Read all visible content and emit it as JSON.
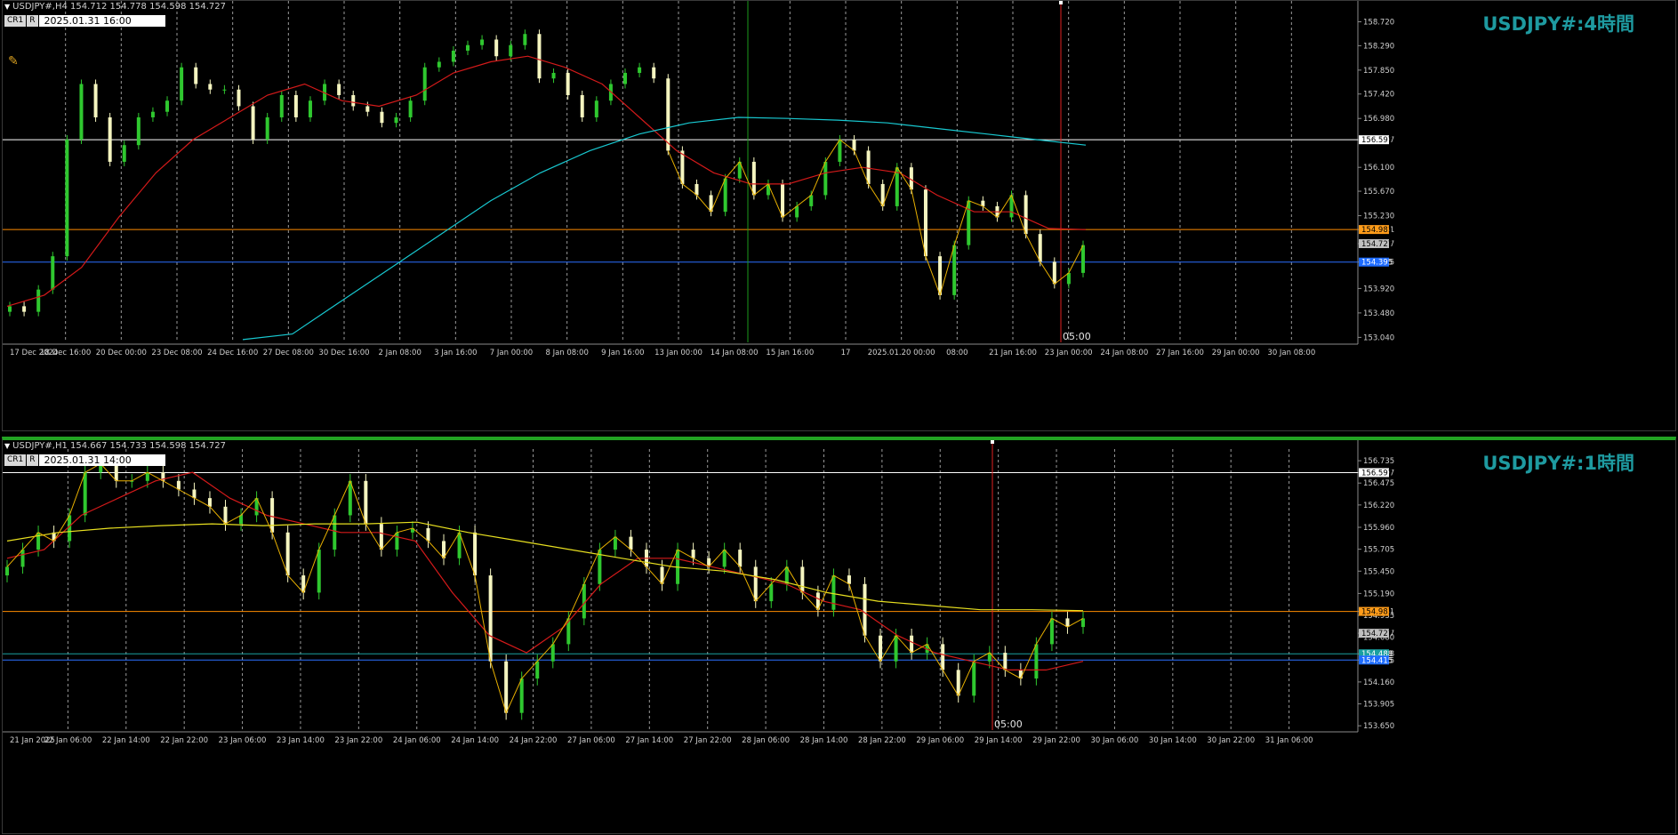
{
  "pane_h4": {
    "header": "USDJPY#,H4  154.712 154.778 154.598 154.727",
    "cr_label": "CR1",
    "r_label": "R",
    "datetime": "2025.01.31 16:00",
    "title": "USDJPY#:4時間",
    "y_ticks": [
      "158.720",
      "158.290",
      "157.850",
      "157.420",
      "156.980",
      "156.597",
      "156.100",
      "155.670",
      "155.230",
      "154.981",
      "154.727",
      "154.395",
      "153.920",
      "153.480",
      "153.040"
    ],
    "y_ticks_values": [
      158.72,
      158.29,
      157.85,
      157.42,
      156.98,
      156.597,
      156.1,
      155.67,
      155.23,
      154.981,
      154.727,
      154.395,
      153.92,
      153.48,
      153.04
    ],
    "highlight_labels": [
      {
        "text": "156.597",
        "bg": "#ffffff",
        "fg": "#000000",
        "value": 156.597
      },
      {
        "text": "154.981",
        "bg": "#ff9c1a",
        "fg": "#000000",
        "value": 154.981
      },
      {
        "text": "154.727",
        "bg": "#c0c0c0",
        "fg": "#000000",
        "value": 154.727
      },
      {
        "text": "154.395",
        "bg": "#1e6cff",
        "fg": "#ffffff",
        "value": 154.395
      }
    ],
    "x_labels": [
      "17 Dec 2024",
      "18 Dec 16:00",
      "20 Dec 00:00",
      "23 Dec 08:00",
      "24 Dec 16:00",
      "27 Dec 08:00",
      "30 Dec 16:00",
      "2 Jan 08:00",
      "3 Jan 16:00",
      "7 Jan 00:00",
      "8 Jan 08:00",
      "9 Jan 16:00",
      "13 Jan 00:00",
      "14 Jan 08:00",
      "15 Jan 16:00",
      "17",
      "2025.01.20 00:00",
      "08:00",
      "21 Jan 16:00",
      "23 Jan 00:00",
      "24 Jan 08:00",
      "27 Jan 16:00",
      "29 Jan 00:00",
      "30 Jan 08:00"
    ],
    "cursor_time": "05:00",
    "colors": {
      "ma_short": "#d41a1a",
      "ma_long": "#18c8d0",
      "zigzag": "#e8b000",
      "hline_white": "#ffffff",
      "hline_orange": "#ff8c00",
      "hline_blue": "#2a6fff",
      "vline_red": "#e02020",
      "vline_green": "#1c9a1c",
      "candle_bull": "#2fc82f",
      "candle_bear": "#f5f5c0"
    }
  },
  "pane_h1": {
    "header": "USDJPY#,H1  154.667 154.733 154.598 154.727",
    "cr_label": "CR1",
    "r_label": "R",
    "datetime": "2025.01.31 14:00",
    "title": "USDJPY#:1時間",
    "y_ticks": [
      "156.735",
      "156.597",
      "156.475",
      "156.220",
      "155.960",
      "155.705",
      "155.450",
      "155.190",
      "154.981",
      "154.935",
      "154.727",
      "154.680",
      "154.488",
      "154.415",
      "154.160",
      "153.905",
      "153.650"
    ],
    "y_ticks_values": [
      156.735,
      156.597,
      156.475,
      156.22,
      155.96,
      155.705,
      155.45,
      155.19,
      154.981,
      154.935,
      154.727,
      154.68,
      154.488,
      154.415,
      154.16,
      153.905,
      153.65
    ],
    "highlight_labels": [
      {
        "text": "156.597",
        "bg": "#ffffff",
        "fg": "#000000",
        "value": 156.597
      },
      {
        "text": "154.981",
        "bg": "#ff9c1a",
        "fg": "#000000",
        "value": 154.981
      },
      {
        "text": "154.727",
        "bg": "#c0c0c0",
        "fg": "#000000",
        "value": 154.727
      },
      {
        "text": "154.488",
        "bg": "#1aa0a0",
        "fg": "#ffffff",
        "value": 154.488
      },
      {
        "text": "154.415",
        "bg": "#1e6cff",
        "fg": "#ffffff",
        "value": 154.415
      }
    ],
    "x_labels": [
      "21 Jan 2025",
      "22 Jan 06:00",
      "22 Jan 14:00",
      "22 Jan 22:00",
      "23 Jan 06:00",
      "23 Jan 14:00",
      "23 Jan 22:00",
      "24 Jan 06:00",
      "24 Jan 14:00",
      "24 Jan 22:00",
      "27 Jan 06:00",
      "27 Jan 14:00",
      "27 Jan 22:00",
      "28 Jan 06:00",
      "28 Jan 14:00",
      "28 Jan 22:00",
      "29 Jan 06:00",
      "29 Jan 14:00",
      "29 Jan 22:00",
      "30 Jan 06:00",
      "30 Jan 14:00",
      "30 Jan 22:00",
      "31 Jan 06:00"
    ],
    "cursor_time": "05:00",
    "colors": {
      "ma_short": "#d41a1a",
      "ma_long": "#e8e020",
      "zigzag": "#e8b000",
      "hline_white": "#ffffff",
      "hline_orange": "#ff8c00",
      "hline_teal": "#1aa0a0",
      "hline_blue": "#2a6fff",
      "vline_red": "#e02020",
      "candle_bull": "#2fc82f",
      "candle_bear": "#f5f5c0"
    }
  },
  "chart_data": [
    {
      "type": "candlestick",
      "title": "USDJPY#:4時間",
      "ylim": [
        152.95,
        159.0
      ],
      "series": [
        {
          "name": "close",
          "values": [
            153.6,
            153.5,
            153.9,
            154.5,
            156.6,
            157.6,
            157.0,
            156.2,
            156.5,
            157.0,
            157.1,
            157.3,
            157.9,
            157.6,
            157.5,
            157.5,
            157.2,
            156.6,
            157.0,
            157.4,
            157.0,
            157.3,
            157.6,
            157.4,
            157.2,
            157.1,
            156.9,
            157.0,
            157.3,
            157.9,
            158.0,
            158.2,
            158.3,
            158.4,
            158.1,
            158.3,
            158.5,
            157.7,
            157.8,
            157.4,
            157.0,
            157.3,
            157.6,
            157.8,
            157.9,
            157.7,
            156.4,
            155.8,
            155.6,
            155.3,
            155.9,
            156.2,
            155.6,
            155.8,
            155.2,
            155.4,
            155.6,
            156.2,
            156.6,
            156.4,
            155.8,
            155.4,
            156.1,
            155.7,
            154.5,
            153.8,
            154.7,
            155.5,
            155.4,
            155.2,
            155.6,
            154.9,
            154.4,
            154.0,
            154.2,
            154.7
          ]
        }
      ],
      "moving_averages": [
        {
          "color": "#d41a1a",
          "values": [
            153.6,
            153.8,
            154.3,
            155.2,
            156.0,
            156.6,
            157.0,
            157.4,
            157.6,
            157.3,
            157.2,
            157.4,
            157.8,
            158.0,
            158.1,
            157.9,
            157.6,
            157.0,
            156.4,
            156.0,
            155.8,
            155.8,
            156.0,
            156.1,
            156.0,
            155.6,
            155.3,
            155.3,
            155.0,
            154.98
          ]
        },
        {
          "color": "#18c8d0",
          "values": [
            153.0,
            153.1,
            153.7,
            154.3,
            154.9,
            155.5,
            156.0,
            156.4,
            156.7,
            156.9,
            157.0,
            156.98,
            156.95,
            156.9,
            156.8,
            156.7,
            156.6,
            156.5
          ]
        }
      ],
      "horizontal_lines": [
        156.597,
        154.981,
        154.395
      ]
    },
    {
      "type": "candlestick",
      "title": "USDJPY#:1時間",
      "ylim": [
        153.6,
        156.85
      ],
      "series": [
        {
          "name": "close",
          "values": [
            155.5,
            155.7,
            155.9,
            155.8,
            156.1,
            156.6,
            156.7,
            156.5,
            156.5,
            156.6,
            156.5,
            156.4,
            156.3,
            156.2,
            156.0,
            156.1,
            156.3,
            155.9,
            155.4,
            155.2,
            155.7,
            156.1,
            156.5,
            156.0,
            155.7,
            155.9,
            155.95,
            155.8,
            155.6,
            155.9,
            155.4,
            154.4,
            153.8,
            154.2,
            154.4,
            154.6,
            154.9,
            155.3,
            155.7,
            155.85,
            155.7,
            155.5,
            155.3,
            155.7,
            155.6,
            155.5,
            155.7,
            155.5,
            155.1,
            155.3,
            155.5,
            155.2,
            155.0,
            155.4,
            155.3,
            154.7,
            154.4,
            154.7,
            154.5,
            154.6,
            154.3,
            154.0,
            154.4,
            154.5,
            154.3,
            154.2,
            154.6,
            154.9,
            154.8,
            154.9
          ]
        }
      ],
      "moving_averages": [
        {
          "color": "#d41a1a",
          "values": [
            155.6,
            155.7,
            156.1,
            156.3,
            156.5,
            156.6,
            156.3,
            156.1,
            156.0,
            155.9,
            155.9,
            155.8,
            155.2,
            154.7,
            154.5,
            154.8,
            155.3,
            155.6,
            155.6,
            155.5,
            155.4,
            155.3,
            155.1,
            155.0,
            154.7,
            154.5,
            154.4,
            154.3,
            154.3,
            154.4
          ]
        },
        {
          "color": "#e8e020",
          "values": [
            155.8,
            155.9,
            155.95,
            155.98,
            156.0,
            155.98,
            156.0,
            156.0,
            156.02,
            155.9,
            155.8,
            155.7,
            155.6,
            155.5,
            155.45,
            155.35,
            155.2,
            155.1,
            155.05,
            155.0,
            155.0,
            154.99
          ]
        }
      ],
      "horizontal_lines": [
        156.597,
        154.981,
        154.488,
        154.415
      ]
    }
  ]
}
